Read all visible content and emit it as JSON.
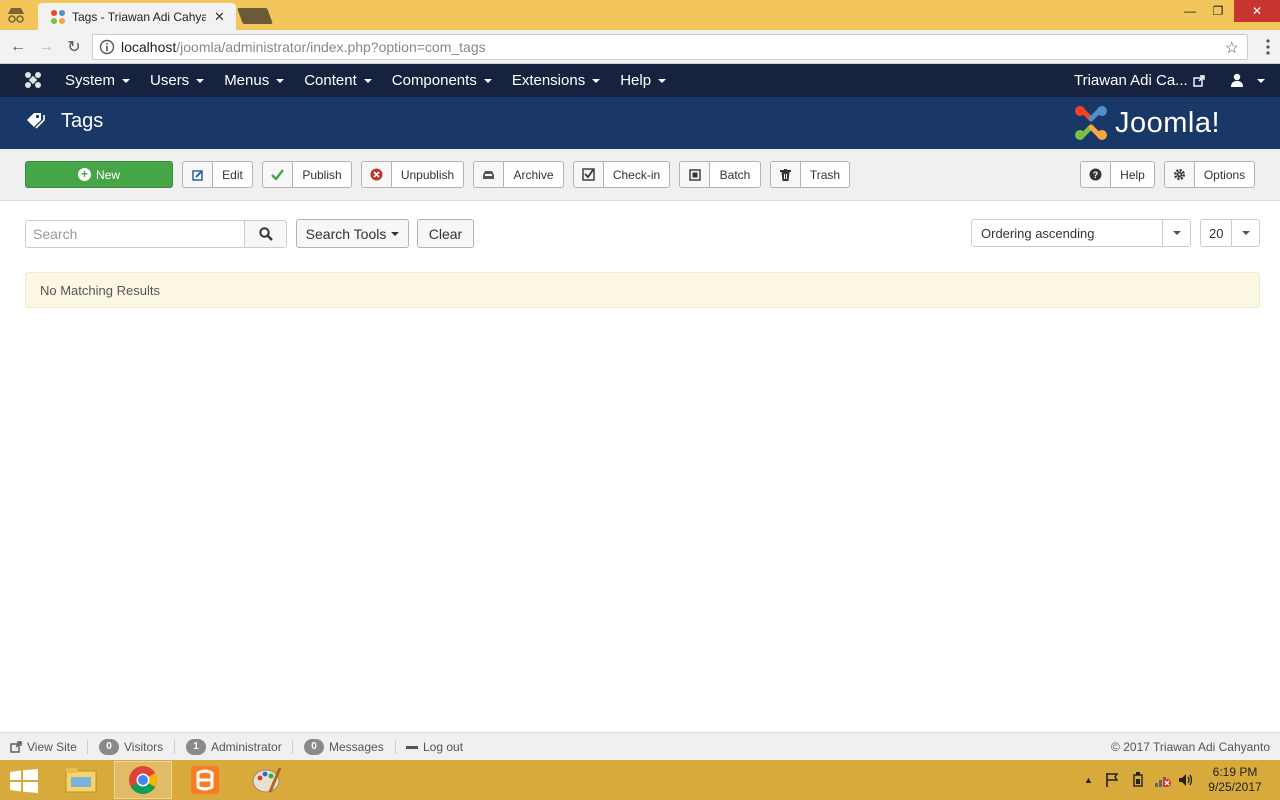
{
  "browser": {
    "tab_title": "Tags - Triawan Adi Cahyanto",
    "url_host": "localhost",
    "url_path": "/joomla/administrator/index.php?option=com_tags"
  },
  "nav": {
    "menus": [
      "System",
      "Users",
      "Menus",
      "Content",
      "Components",
      "Extensions",
      "Help"
    ],
    "user_name": "Triawan Adi Ca..."
  },
  "header": {
    "title": "Tags",
    "brand": "Joomla!"
  },
  "toolbar": {
    "new": "New",
    "edit": "Edit",
    "publish": "Publish",
    "unpublish": "Unpublish",
    "archive": "Archive",
    "checkin": "Check-in",
    "batch": "Batch",
    "trash": "Trash",
    "help": "Help",
    "options": "Options"
  },
  "filters": {
    "search_placeholder": "Search",
    "search_tools": "Search Tools",
    "clear": "Clear",
    "ordering": "Ordering ascending",
    "limit": "20"
  },
  "alert": {
    "message": "No Matching Results"
  },
  "statusbar": {
    "view_site": "View Site",
    "visitors_count": "0",
    "visitors": "Visitors",
    "admin_count": "1",
    "admin": "Administrator",
    "messages_count": "0",
    "messages": "Messages",
    "logout": "Log out",
    "copyright": "© 2017 Triawan Adi Cahyanto"
  },
  "taskbar": {
    "time": "6:19 PM",
    "date": "9/25/2017"
  },
  "colors": {
    "nav_bg": "#17233e",
    "header_bg": "#1a3867",
    "new_button": "#46a546",
    "alert_bg": "#fcf8e3"
  }
}
